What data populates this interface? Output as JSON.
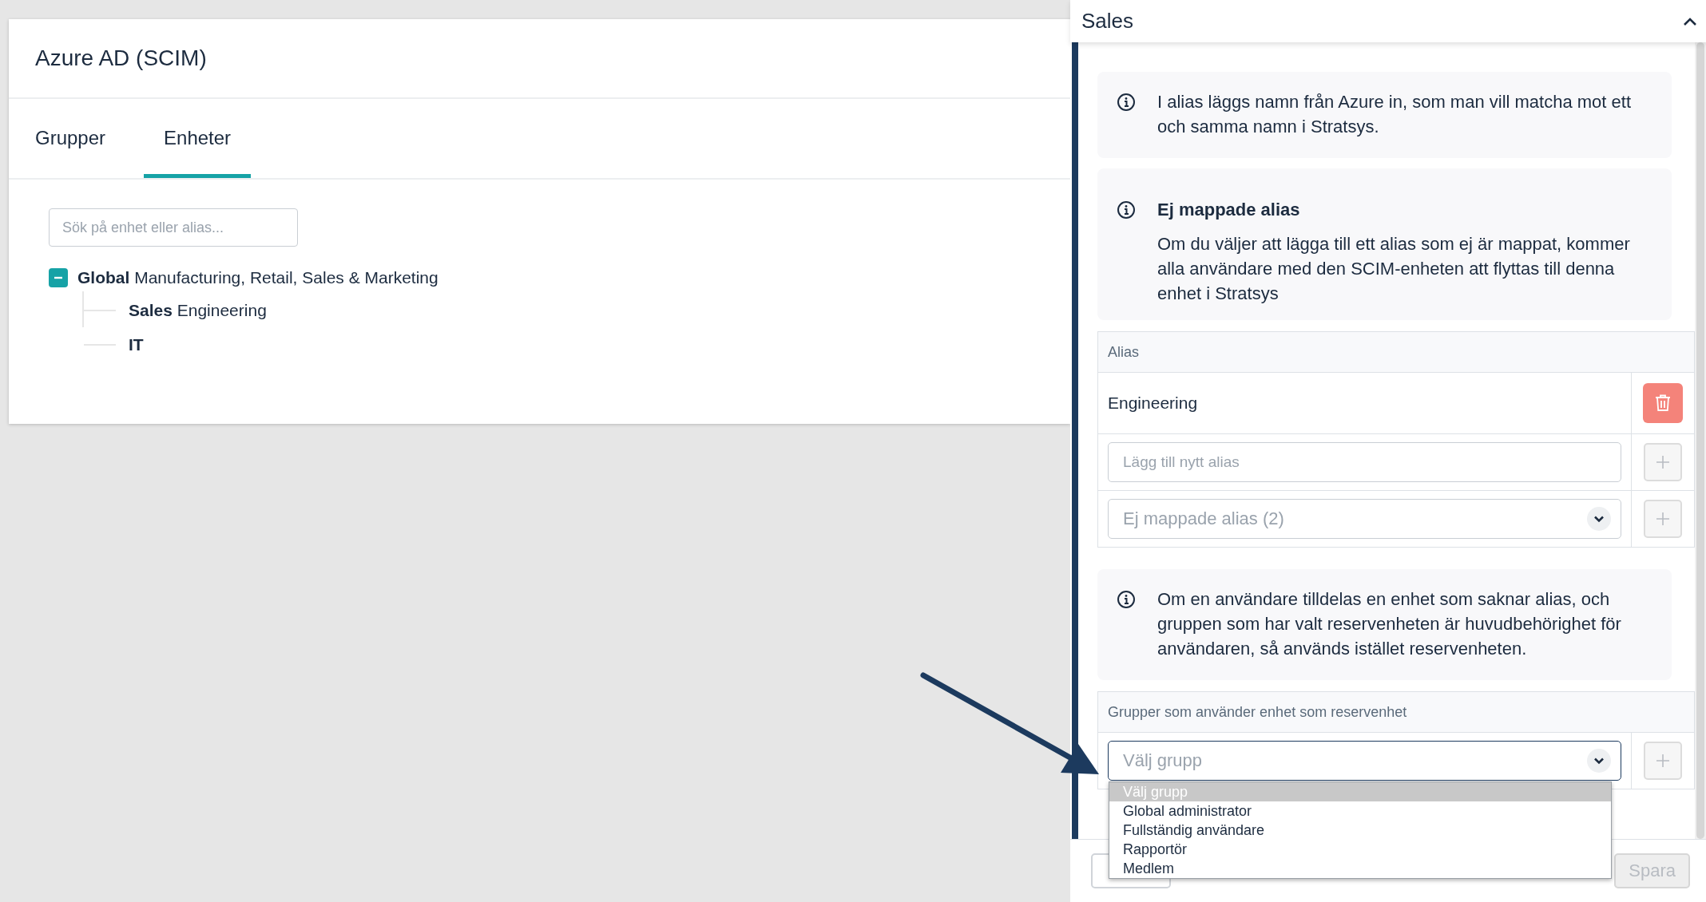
{
  "integration": {
    "title": "Azure AD (SCIM)",
    "tabs": [
      {
        "label": "Grupper",
        "selected": false
      },
      {
        "label": "Enheter",
        "selected": true
      }
    ],
    "search": {
      "placeholder": "Sök på enhet eller alias..."
    },
    "tree": [
      {
        "label": "**Global** Manufacturing, Retail, Sales & Marketing",
        "expanded": true,
        "children": [
          {
            "label": "**Sales** Engineering"
          },
          {
            "label": "**IT**"
          }
        ]
      }
    ]
  },
  "panel": {
    "title": "Sales",
    "expanded": true,
    "notes": [
      {
        "text": "I alias läggs namn från Azure in, som man vill matcha mot ett och samma namn i Stratsys."
      },
      {
        "heading": "Ej mappade alias",
        "text": "Om du väljer att lägga till ett alias som ej är mappat, kommer alla användare med den SCIM-enheten att flyttas till denna enhet i Stratsys"
      }
    ],
    "alias_table": {
      "header": "Alias",
      "aliases": [
        "Engineering"
      ],
      "new_alias": {
        "placeholder": "Lägg till nytt alias"
      },
      "unmapped": {
        "placeholder": "Ej mappade alias (2)"
      }
    },
    "fallback_note": {
      "text": "Om en användare tilldelas en enhet som saknar alias, och gruppen som har valt reservenheten är huvudbehörighet för användaren, så används istället reservenheten."
    },
    "groups_table": {
      "header": "Grupper som använder enhet som reservenhet",
      "select": {
        "placeholder": "Välj grupp",
        "open": true
      },
      "options": [
        {
          "label": "Välj grupp",
          "selected": true
        },
        {
          "label": "Global administrator",
          "selected": false
        },
        {
          "label": "Fullständig användare",
          "selected": false
        },
        {
          "label": "Rapportör",
          "selected": false
        },
        {
          "label": "Medlem",
          "selected": false
        }
      ]
    },
    "footer": {
      "save": "Spara",
      "save_disabled": true
    }
  }
}
